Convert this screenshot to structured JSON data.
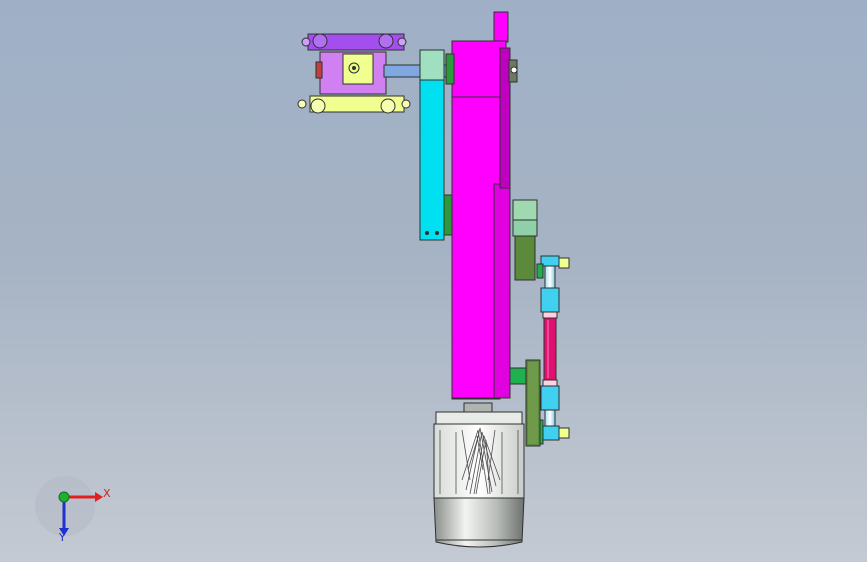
{
  "app": {
    "window": "cad-3d-viewport",
    "model": "mechanical-arm-assembly",
    "view": "front"
  },
  "triad": {
    "x_label": "X",
    "y_label": "Y",
    "colors": {
      "x": "#e02020",
      "y": "#2030d0",
      "z": "#20b030"
    }
  },
  "colors": {
    "background_top": "#9fb0c6",
    "background_bottom": "#c4cad3",
    "main_column": "#ff00ff",
    "top_clamp": "#a44ef0",
    "clamp_pads": "#f0ff90",
    "link_arm": "#00e0f0",
    "cylinder_rod": "#e01070",
    "rod_ends": "#40d0f0",
    "bracket": "#5a8a3a",
    "pivot_block": "#a0d8b0",
    "motor_housing": "#c8ccc8",
    "pin": "#20b050"
  },
  "components": [
    {
      "id": "main-column",
      "icon": "column-block"
    },
    {
      "id": "top-clamp-assembly",
      "icon": "clamp"
    },
    {
      "id": "cyan-link-arm",
      "icon": "link"
    },
    {
      "id": "pneumatic-cylinder",
      "icon": "cylinder"
    },
    {
      "id": "motor",
      "icon": "motor"
    },
    {
      "id": "lower-bracket",
      "icon": "bracket"
    }
  ]
}
